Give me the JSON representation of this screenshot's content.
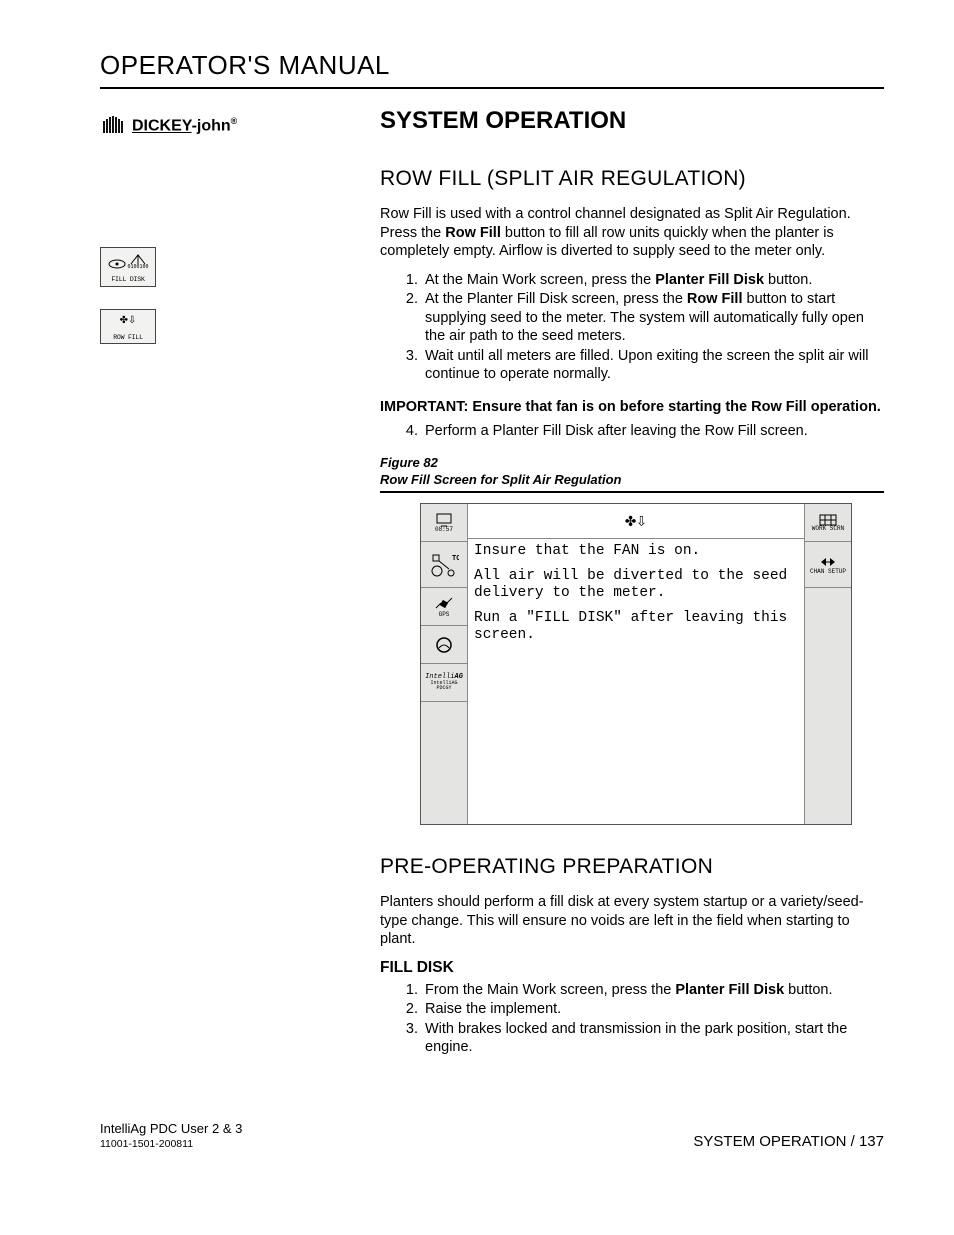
{
  "header": {
    "title": "OPERATOR'S MANUAL"
  },
  "brand": {
    "name": "DICKEY-john",
    "reg": "®"
  },
  "sideButtons": [
    {
      "label": "FILL DISK"
    },
    {
      "label": "ROW FILL"
    }
  ],
  "section": {
    "title": "SYSTEM OPERATION",
    "rowFill": {
      "heading": "ROW FILL (SPLIT AIR REGULATION)",
      "intro_a": "Row Fill is used with a control channel designated as Split Air Regulation. Press the ",
      "intro_bold": "Row Fill",
      "intro_b": " button to fill all row units quickly when the planter is completely empty. Airflow is diverted to supply seed to the meter only.",
      "steps": [
        {
          "pre": "At the Main Work screen, press the ",
          "bold": "Planter Fill Disk",
          "post": " button."
        },
        {
          "pre": "At the Planter Fill Disk screen, press the ",
          "bold": "Row Fill",
          "post": " button to start supplying seed to the meter.  The system will automatically fully open the air path to the seed meters."
        },
        {
          "pre": "Wait until all meters are filled. Upon exiting the screen the split air will continue to operate normally.",
          "bold": "",
          "post": ""
        }
      ],
      "importantLabel": "IMPORTANT:",
      "importantText": "Ensure that fan is on before starting the Row Fill operation.",
      "step4": "Perform a Planter Fill Disk after leaving the Row Fill screen.",
      "figureNum": "Figure 82",
      "figureCaption": "Row Fill Screen for Split Air Regulation"
    },
    "preOp": {
      "heading": "PRE-OPERATING PREPARATION",
      "intro": "Planters should perform a fill disk at every system startup or a variety/seed-type change. This will ensure no voids are left in the field when starting to plant.",
      "fillDiskHeading": "FILL DISK",
      "fillDiskSteps": [
        {
          "pre": "From the Main Work screen, press the ",
          "bold": "Planter Fill Disk",
          "post": " button."
        },
        {
          "pre": "Raise the implement.",
          "bold": "",
          "post": ""
        },
        {
          "pre": "With brakes locked and transmission in the park position, start the engine.",
          "bold": "",
          "post": ""
        }
      ]
    }
  },
  "screenshot": {
    "headerIcon": "✤⇩",
    "leftButtons": [
      {
        "time": "08:57"
      },
      {
        "label": "TC"
      },
      {
        "label": "GPS"
      },
      {
        "label": ""
      },
      {
        "label": "IntelliAG PDCGY"
      }
    ],
    "rightButtons": [
      {
        "label": "WORK SCRN"
      },
      {
        "label": "CHAN SETUP"
      }
    ],
    "body_line1": "Insure that the FAN is on.",
    "body_line2": "All air will be diverted to the seed delivery to the meter.",
    "body_line3": "Run a \"FILL DISK\" after leaving this screen."
  },
  "footer": {
    "product": "IntelliAg PDC User 2 & 3",
    "docnum": "11001-1501-200811",
    "right": "SYSTEM OPERATION / 137"
  }
}
